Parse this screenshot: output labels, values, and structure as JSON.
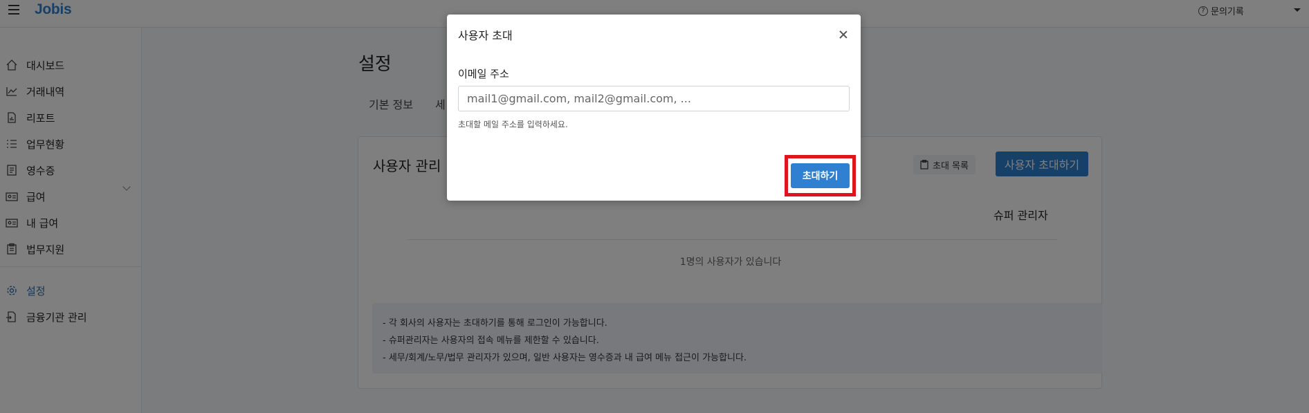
{
  "header": {
    "logo": "Jobis",
    "help_label": "문의기록"
  },
  "sidebar": {
    "items": [
      {
        "label": "대시보드",
        "icon": "home-icon"
      },
      {
        "label": "거래내역",
        "icon": "chart-line-icon"
      },
      {
        "label": "리포트",
        "icon": "report-icon"
      },
      {
        "label": "업무현황",
        "icon": "task-list-icon"
      },
      {
        "label": "영수증",
        "icon": "receipt-icon"
      },
      {
        "label": "급여",
        "icon": "id-card-icon"
      },
      {
        "label": "내 급여",
        "icon": "id-card-icon"
      },
      {
        "label": "법무지원",
        "icon": "clipboard-icon"
      },
      {
        "label": "설정",
        "icon": "gear-icon",
        "active": true
      },
      {
        "label": "금융기관 관리",
        "icon": "bank-file-icon"
      }
    ]
  },
  "main": {
    "page_title": "설정",
    "tabs": [
      "기본 정보",
      "세"
    ],
    "card": {
      "title": "사용자 관리",
      "invite_list_label": "초대 목록",
      "invite_user_label": "사용자 초대하기",
      "column_header": "슈퍼 관리자",
      "user_count": "1명의 사용자가 있습니다",
      "notes": [
        "- 각 회사의 사용자는 초대하기를 통해 로그인이 가능합니다.",
        "- 슈퍼관리자는 사용자의 접속 메뉴를 제한할 수 있습니다.",
        "- 세무/회계/노무/법무 관리자가 있으며, 일반 사용자는 영수증과 내 급여 메뉴 접근이 가능합니다."
      ]
    }
  },
  "modal": {
    "title": "사용자 초대",
    "field_label": "이메일 주소",
    "placeholder": "mail1@gmail.com, mail2@gmail.com, ...",
    "help_text": "초대할 메일 주소를 입력하세요.",
    "submit_label": "초대하기",
    "highlight_color": "#e0141e"
  },
  "colors": {
    "accent": "#2f80d1",
    "active_nav": "#2f6fb2"
  }
}
